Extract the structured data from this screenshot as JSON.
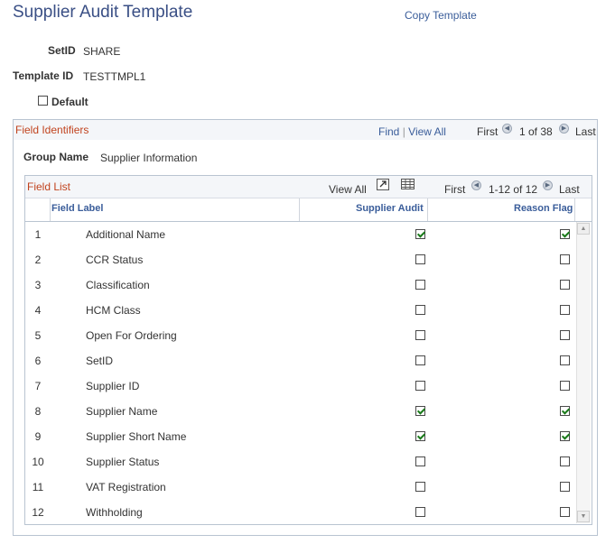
{
  "header": {
    "title": "Supplier Audit Template",
    "copy_link": "Copy Template"
  },
  "fields": {
    "setid_label": "SetID",
    "setid_value": "SHARE",
    "template_label": "Template ID",
    "template_value": "TESTTMPL1",
    "default_label": "Default",
    "default_checked": false
  },
  "field_identifiers": {
    "title": "Field Identifiers",
    "find": "Find",
    "separator": "|",
    "view_all": "View All",
    "first": "First",
    "count": "1 of 38",
    "last": "Last",
    "group_name_label": "Group Name",
    "group_name_value": "Supplier Information"
  },
  "field_list": {
    "title": "Field List",
    "view_all": "View All",
    "first": "First",
    "count": "1-12 of 12",
    "last": "Last",
    "columns": {
      "label": "Field Label",
      "audit": "Supplier Audit",
      "reason": "Reason Flag"
    },
    "rows": [
      {
        "num": "1",
        "label": "Additional Name",
        "audit": true,
        "reason": true
      },
      {
        "num": "2",
        "label": "CCR Status",
        "audit": false,
        "reason": false
      },
      {
        "num": "3",
        "label": "Classification",
        "audit": false,
        "reason": false
      },
      {
        "num": "4",
        "label": "HCM Class",
        "audit": false,
        "reason": false
      },
      {
        "num": "5",
        "label": "Open For Ordering",
        "audit": false,
        "reason": false
      },
      {
        "num": "6",
        "label": "SetID",
        "audit": false,
        "reason": false
      },
      {
        "num": "7",
        "label": "Supplier ID",
        "audit": false,
        "reason": false
      },
      {
        "num": "8",
        "label": "Supplier Name",
        "audit": true,
        "reason": true
      },
      {
        "num": "9",
        "label": "Supplier Short Name",
        "audit": true,
        "reason": true
      },
      {
        "num": "10",
        "label": "Supplier Status",
        "audit": false,
        "reason": false
      },
      {
        "num": "11",
        "label": "VAT Registration",
        "audit": false,
        "reason": false
      },
      {
        "num": "12",
        "label": "Withholding",
        "audit": false,
        "reason": false
      }
    ]
  },
  "icons": {
    "prev": "chevron-left-icon",
    "next": "chevron-right-icon",
    "zoom": "zoom-grid-icon",
    "download": "download-grid-icon"
  },
  "colors": {
    "title": "#3a4f85",
    "link": "#3a5d9a",
    "box_title": "#c1431e",
    "check": "#1a7a1a"
  }
}
